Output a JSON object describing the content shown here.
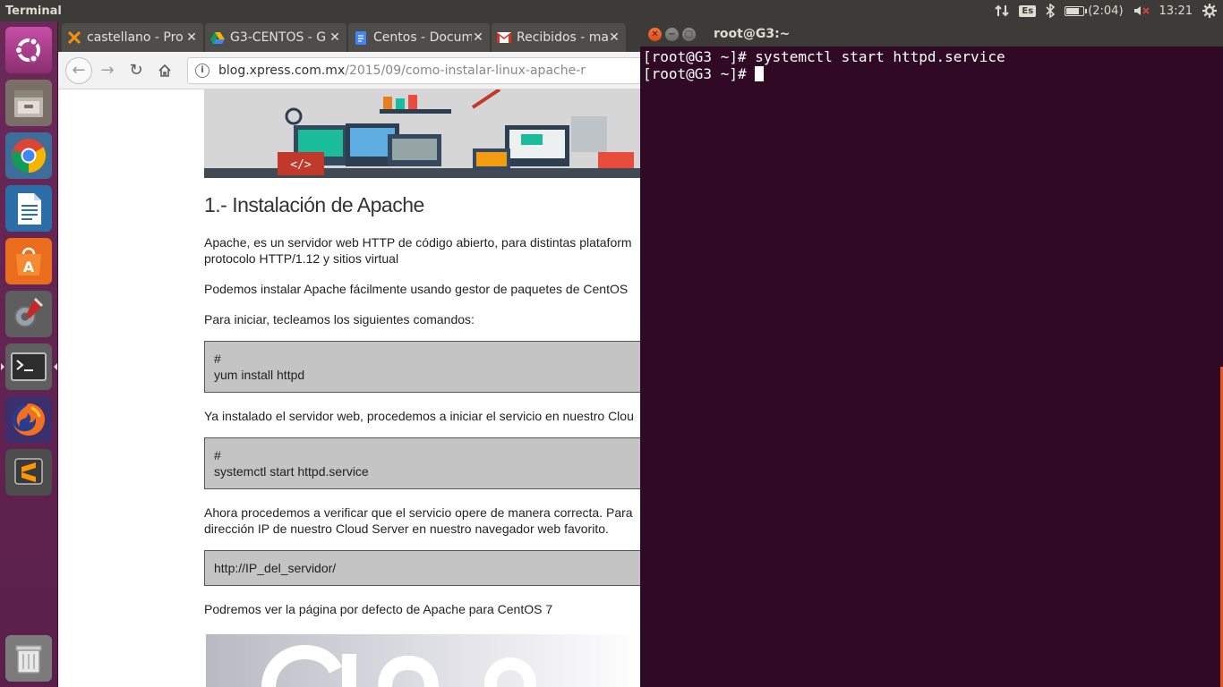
{
  "panel": {
    "app_title": "Terminal",
    "keyboard_layout": "Es",
    "battery_text": "(2:04)",
    "battery_level": 0.85,
    "clock": "13:21"
  },
  "launcher": {
    "items": [
      "ubuntu-dash",
      "files",
      "chrome",
      "writer",
      "software-center",
      "system-settings",
      "terminal",
      "firefox",
      "sublime-text",
      "trash"
    ]
  },
  "browser": {
    "tabs": [
      {
        "title": "castellano - Pro",
        "icon": "xpress-icon"
      },
      {
        "title": "G3-CENTOS - G",
        "icon": "drive-icon"
      },
      {
        "title": "Centos - Docum",
        "icon": "docs-icon"
      },
      {
        "title": "Recibidos - ma",
        "icon": "gmail-icon"
      }
    ],
    "url_domain": "blog.xpress.com.mx",
    "url_path": "/2015/09/como-instalar-linux-apache-r"
  },
  "article": {
    "heading": "1.- Instalación de Apache",
    "para1_line1": "Apache, es un servidor web HTTP de código abierto, para distintas plataform",
    "para1_line2": "protocolo HTTP/1.12 y sitios virtual",
    "para2": "Podemos instalar Apache fácilmente usando gestor de paquetes de CentOS",
    "para3": "Para iniciar, tecleamos los siguientes comandos:",
    "code1_line1": "#",
    "code1_line2": "yum install httpd",
    "para4": "Ya instalado el servidor web, procedemos a iniciar el servicio en nuestro Clou",
    "code2_line1": "#",
    "code2_line2": "systemctl start httpd.service",
    "para5_line1": "Ahora procedemos a verificar que el servicio opere de manera correcta. Para",
    "para5_line2": "dirección IP de nuestro Cloud Server en nuestro navegador web favorito.",
    "code3": "http://IP_del_servidor/",
    "para6": "Podremos ver la página por defecto de Apache para CentOS 7"
  },
  "terminal": {
    "title": "root@G3:~",
    "line1_prompt": "[root@G3 ~]# ",
    "line1_cmd": "systemctl start httpd.service",
    "line2_prompt": "[root@G3 ~]# "
  },
  "colors": {
    "terminal_bg": "#300a24",
    "panel_bg": "#3c3b37",
    "launcher_bg": "#5e2750",
    "accent": "#e95420"
  }
}
